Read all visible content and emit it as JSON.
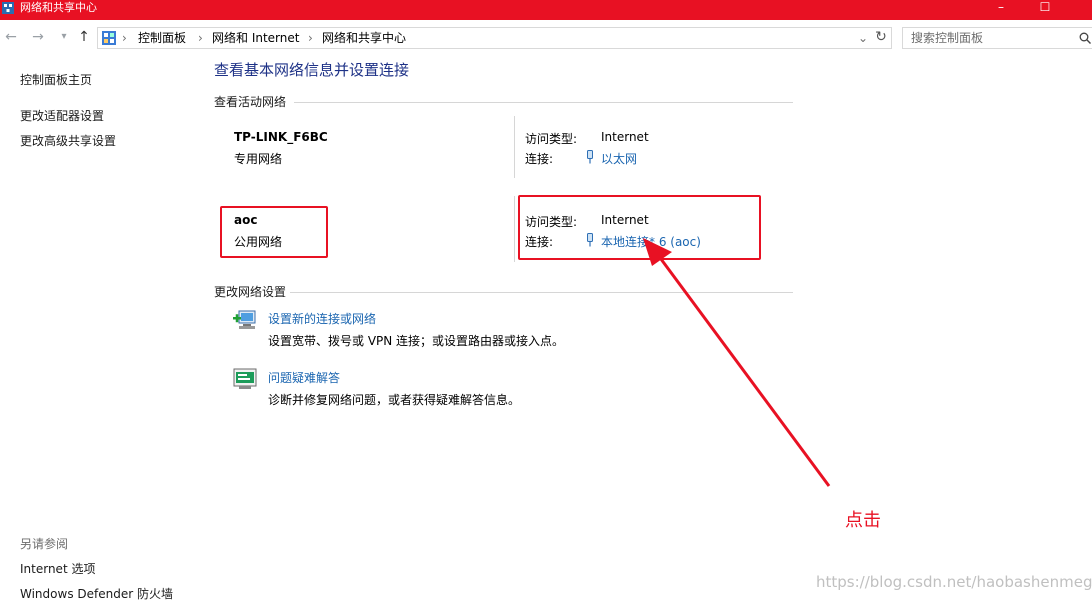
{
  "window": {
    "title": "网络和共享中心",
    "controls": {
      "minimize": "–",
      "maximize": "☐"
    }
  },
  "nav": {
    "back_icon": "arrow-left-icon",
    "forward_icon": "arrow-right-icon",
    "up_icon": "arrow-up-icon",
    "breadcrumb": [
      "控制面板",
      "网络和 Internet",
      "网络和共享中心"
    ],
    "search_placeholder": "搜索控制面板"
  },
  "sidebar": {
    "items": [
      "控制面板主页",
      "更改适配器设置",
      "更改高级共享设置"
    ],
    "see_also_label": "另请参阅",
    "see_also": [
      "Internet 选项",
      "Windows Defender 防火墙"
    ]
  },
  "main": {
    "title": "查看基本网络信息并设置连接",
    "active_label": "查看活动网络",
    "networks": [
      {
        "name": "TP-LINK_F6BC",
        "type": "专用网络",
        "access_label": "访问类型:",
        "access": "Internet",
        "conn_label": "连接:",
        "conn": "以太网"
      },
      {
        "name": "aoc",
        "type": "公用网络",
        "access_label": "访问类型:",
        "access": "Internet",
        "conn_label": "连接:",
        "conn": "本地连接* 6 (aoc)"
      }
    ],
    "change_label": "更改网络设置",
    "tasks": [
      {
        "link": "设置新的连接或网络",
        "desc": "设置宽带、拨号或 VPN 连接；或设置路由器或接入点。"
      },
      {
        "link": "问题疑难解答",
        "desc": "诊断并修复网络问题，或者获得疑难解答信息。"
      }
    ]
  },
  "annotation": {
    "text": "点击",
    "color": "#e81123"
  },
  "watermark": "https://blog.csdn.net/haobashenmegui"
}
